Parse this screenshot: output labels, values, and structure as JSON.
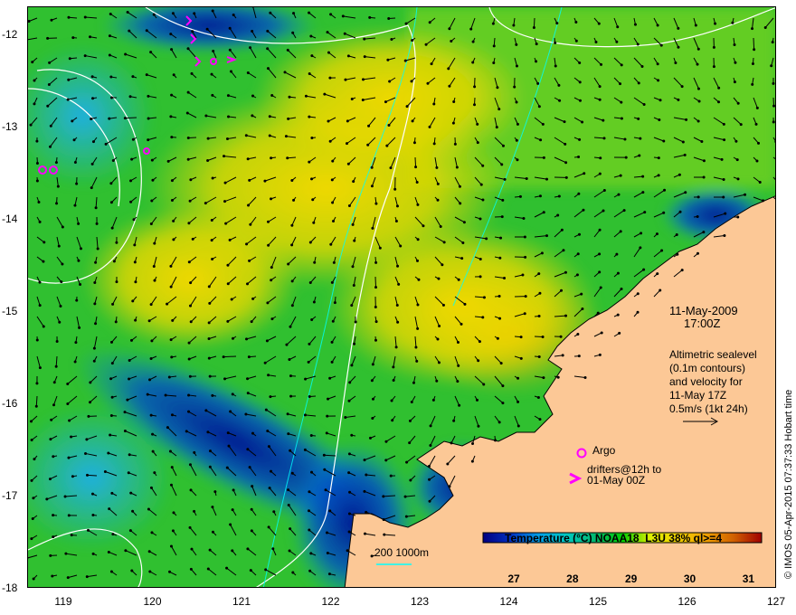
{
  "map": {
    "date": "11-May-2009",
    "time": "17:00Z",
    "legend_lines": [
      "Altimetric sealevel",
      "(0.1m contours)",
      "and velocity for",
      "11-May 17Z",
      "0.5m/s (1kt 24h)"
    ],
    "argo_label": "Argo",
    "drifters_line1": "drifters@12h to",
    "drifters_line2": "01-May 00Z",
    "depth_label": "200  1000m",
    "colorbar_title": "Temperature (°C) NOAA18_L3U 38% ql>=4",
    "colorbar_ticks": [
      "27",
      "28",
      "29",
      "30",
      "31"
    ],
    "lon_ticks": [
      "119",
      "120",
      "121",
      "122",
      "123",
      "124",
      "125",
      "126",
      "127"
    ],
    "lat_ticks": [
      "-12",
      "-13",
      "-14",
      "-15",
      "-16",
      "-17",
      "-18"
    ],
    "credit": "© IMOS 05-Apr-2015 07:37:33 Hobart time",
    "colors": {
      "land": "#fcc896",
      "argo": "#ff00ff",
      "drifter": "#ff00ff",
      "contour": "#ffffff",
      "shelf": "#00ffff"
    },
    "colorbar_colors": [
      "#000080",
      "#0030c0",
      "#00a0e8",
      "#00c8c0",
      "#00b870",
      "#00cc00",
      "#ddf000",
      "#f0d000",
      "#f0a000",
      "#d06000",
      "#a00000"
    ]
  }
}
